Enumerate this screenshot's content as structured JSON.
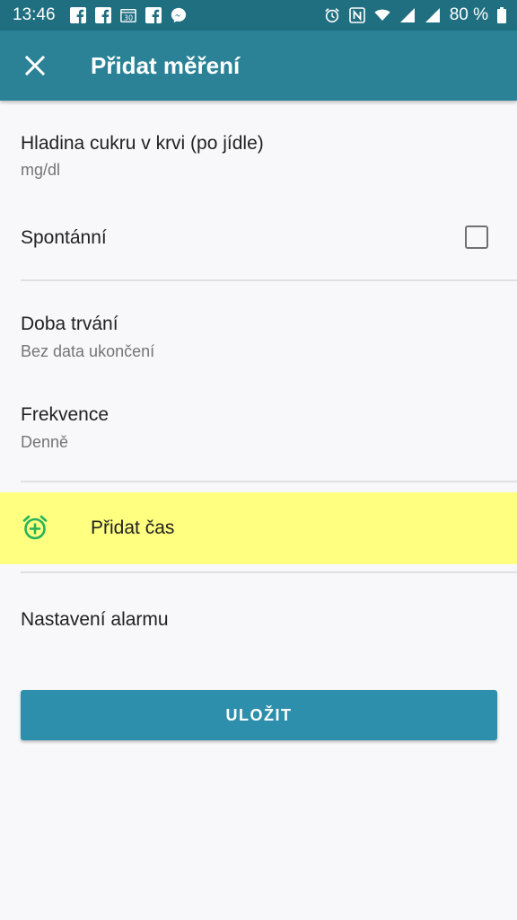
{
  "status_bar": {
    "time": "13:46",
    "left_icons": [
      "facebook-icon",
      "facebook-icon",
      "calendar-icon",
      "facebook-icon",
      "messenger-icon"
    ],
    "calendar_day": "30",
    "right_icons": [
      "alarm-icon",
      "nfc-icon",
      "wifi-icon",
      "signal-icon",
      "signal-icon"
    ],
    "battery": "80 %"
  },
  "app_bar": {
    "title": "Přidat měření",
    "close_icon": "close-icon"
  },
  "items": {
    "measurement": {
      "title": "Hladina cukru v krvi (po jídle)",
      "subtitle": "mg/dl"
    },
    "spontaneous": {
      "title": "Spontánní",
      "checked": false
    },
    "duration": {
      "title": "Doba trvání",
      "subtitle": "Bez data ukončení"
    },
    "frequency": {
      "title": "Frekvence",
      "subtitle": "Denně"
    },
    "add_time": {
      "label": "Přidat čas",
      "icon": "alarm-add-icon"
    },
    "alarm_settings": {
      "title": "Nastavení alarmu"
    }
  },
  "save_button": {
    "label": "ULOŽIT"
  },
  "colors": {
    "status_bar": "#1f6f80",
    "app_bar": "#2b8297",
    "button": "#2e8fac",
    "highlight": "#ffff80",
    "icon_green": "#27b35a"
  }
}
